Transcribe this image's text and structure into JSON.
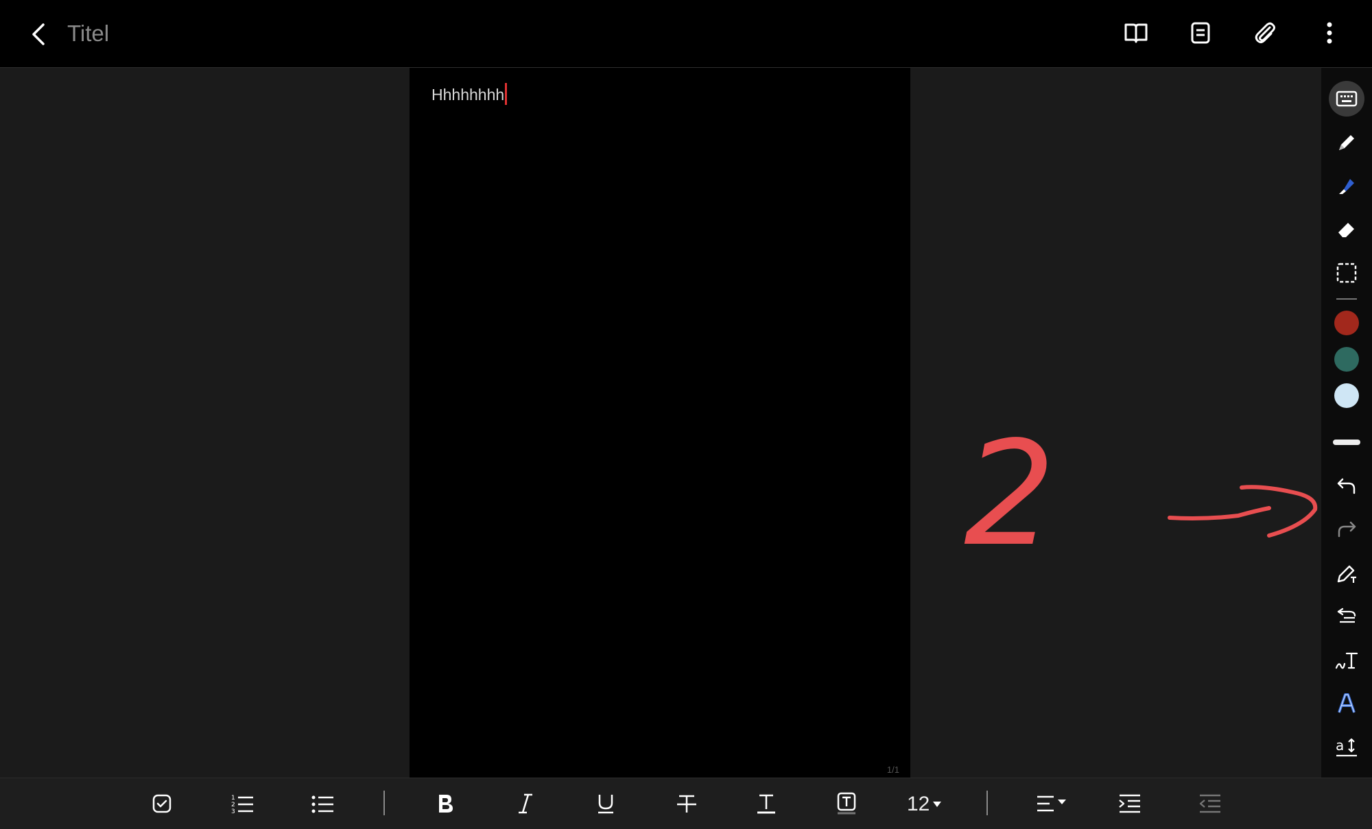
{
  "app": {
    "title": "Titel"
  },
  "toolbar_top": {
    "icons": [
      "back-arrow-icon",
      "book-view-icon",
      "page-view-icon",
      "attachment-icon",
      "more-vertical-icon"
    ]
  },
  "note": {
    "text": "Hhhhhhhh",
    "page_indicator": "1/1"
  },
  "handwriting": {
    "number": "2",
    "color": "#e84e50"
  },
  "pen_toolbar": {
    "tools": [
      "keyboard-icon",
      "pen-icon",
      "highlighter-icon",
      "eraser-icon",
      "selection-icon"
    ],
    "colors": [
      "#a2281c",
      "#2e6a60",
      "#cfe6f5"
    ],
    "actions": [
      "undo-icon",
      "redo-icon",
      "pen-settings-icon",
      "convert-handwriting-icon",
      "handwriting-to-text-icon",
      "text-style-icon",
      "text-size-icon"
    ]
  },
  "format_bar": {
    "font_size": "12",
    "icons": [
      "checkbox-icon",
      "numbered-list-icon",
      "bullet-list-icon",
      "bold-icon",
      "italic-icon",
      "underline-icon",
      "strikethrough-icon",
      "text-color-icon",
      "text-highlight-icon",
      "align-icon",
      "indent-icon",
      "outdent-icon"
    ]
  }
}
